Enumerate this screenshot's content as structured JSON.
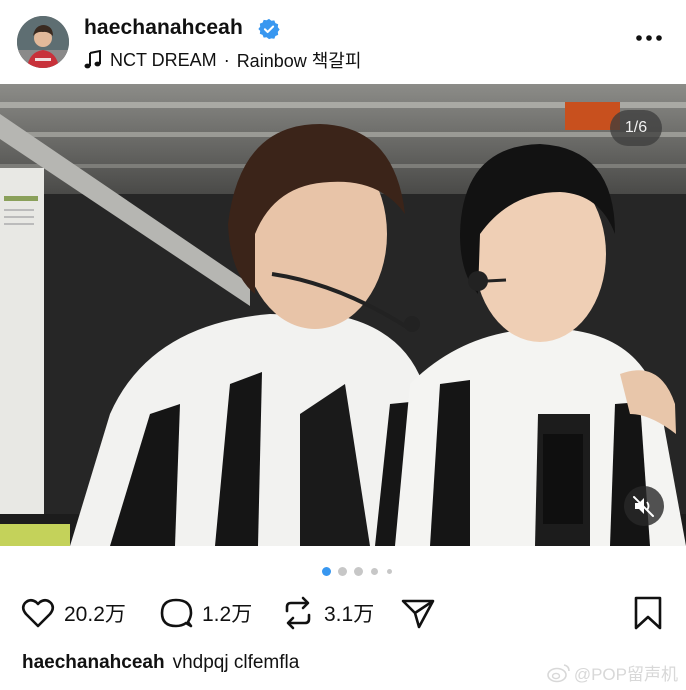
{
  "post": {
    "username": "haechanahceah",
    "music": {
      "artist": "NCT DREAM",
      "separator": "·",
      "song": "Rainbow 책갈피"
    },
    "carousel": {
      "counter": "1/6",
      "total_dots": 5,
      "active_dot": 1
    },
    "actions": {
      "likes": "20.2万",
      "comments": "1.2万",
      "reposts": "3.1万"
    },
    "caption": {
      "username": "haechanahceah",
      "text": "vhdpqj clfemfla"
    },
    "watermark": "@POP留声机"
  },
  "colors": {
    "verified": "#3897f0",
    "active_dot": "#3897f0",
    "inactive_dot": "#c7c7c7",
    "text": "#111111"
  },
  "icons": [
    "verified-badge-icon",
    "music-note-icon",
    "more-options-icon",
    "mute-icon",
    "heart-icon",
    "comment-icon",
    "repost-icon",
    "share-icon",
    "bookmark-icon",
    "weibo-icon"
  ]
}
